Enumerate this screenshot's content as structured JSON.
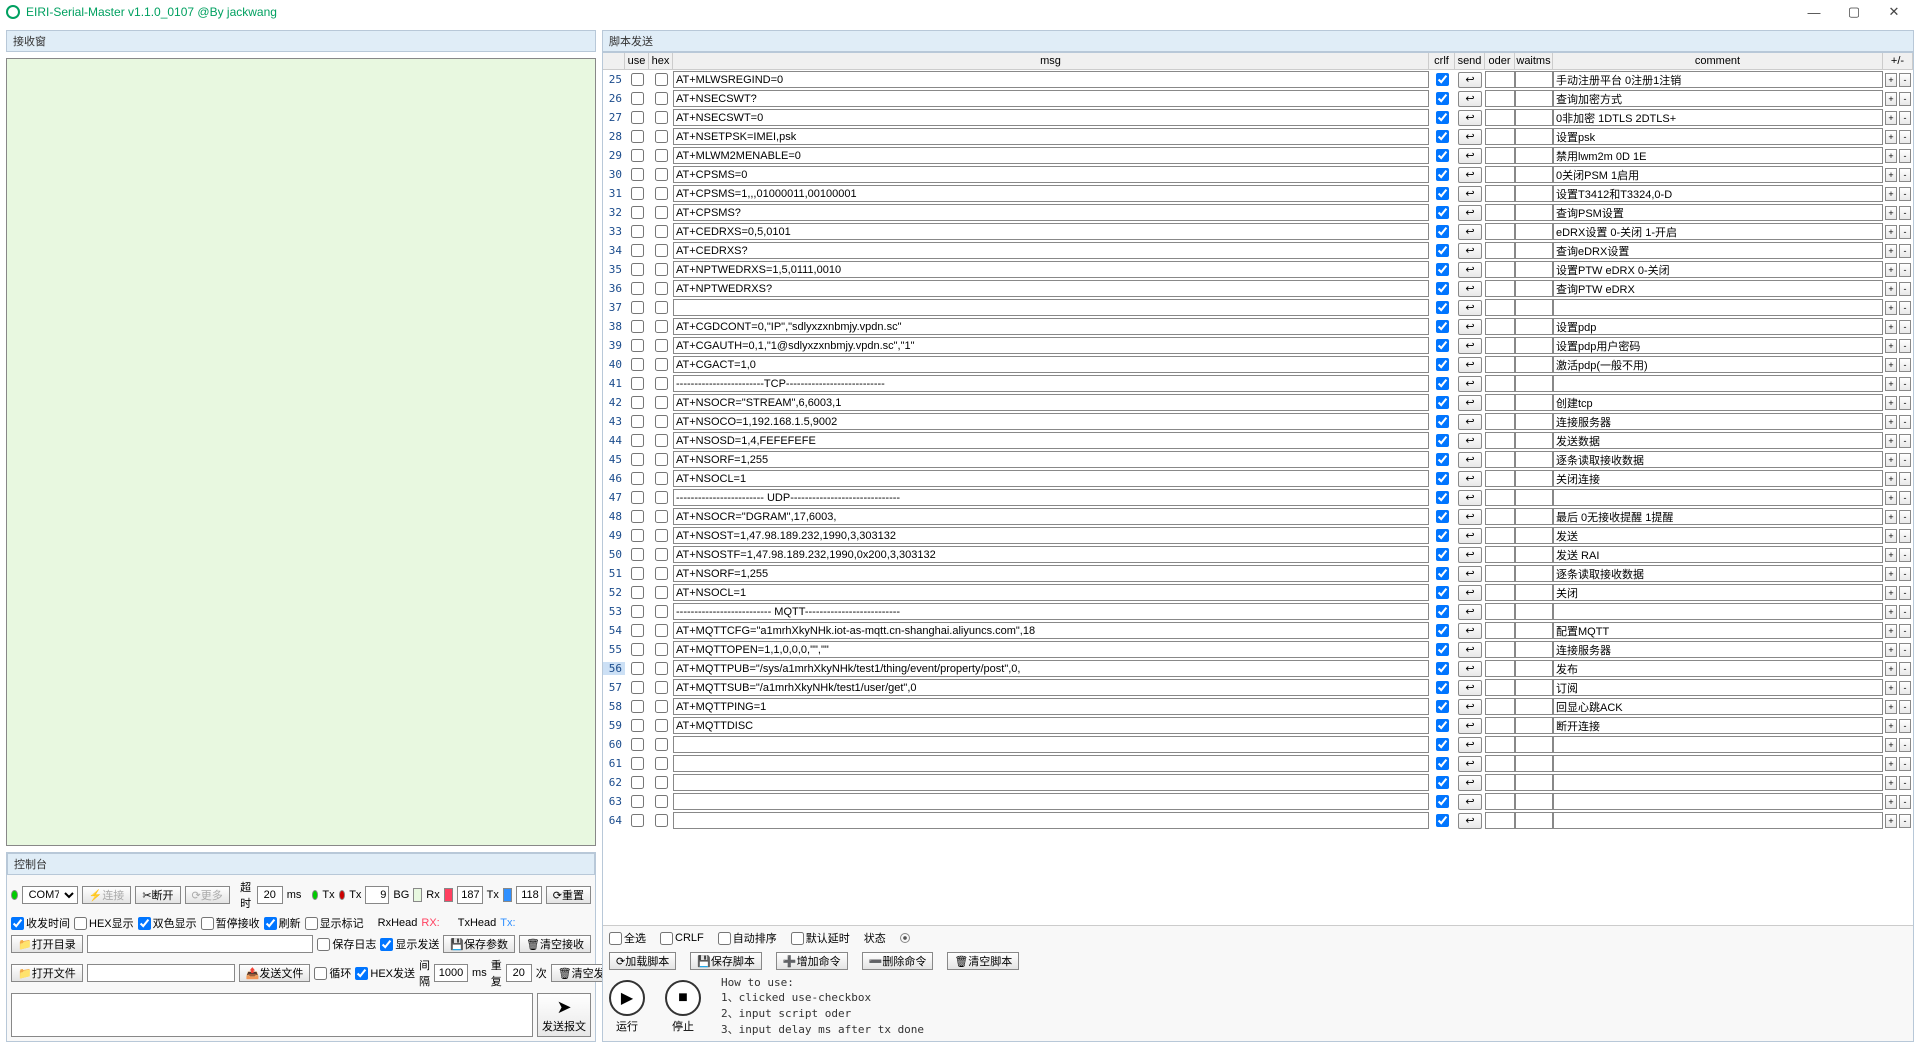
{
  "title": "EIRI-Serial-Master v1.1.0_0107 @By jackwang",
  "panels": {
    "receive": "接收窗",
    "control": "控制台",
    "script": "脚本发送"
  },
  "ctrl": {
    "port": "COM7",
    "connect": "连接",
    "disconnect": "断开",
    "more": "更多",
    "timeout_lbl": "超时",
    "timeout_val": "20",
    "ms": "ms",
    "tx_ok": "Tx",
    "tx_fail": "Tx",
    "tx_num": "9",
    "bg_lbl": "BG",
    "bg_color": "#e8f8e0",
    "rx_lbl": "Rx",
    "rx_color": "#ff4060",
    "rx_num": "187",
    "tx2_lbl": "Tx",
    "tx2_color": "#3090ff",
    "tx2_num": "118",
    "reset": "重置",
    "chk_time": "收发时间",
    "chk_hex": "HEX显示",
    "chk_twocolor": "双色显示",
    "chk_pause": "暂停接收",
    "chk_refresh": "刷新",
    "chk_marker": "显示标记",
    "rxhead_lbl": "RxHead",
    "rx_short": "RX:",
    "txhead_lbl": "TxHead",
    "tx_short": "Tx:",
    "open_dir": "打开目录",
    "open_file": "打开文件",
    "chk_savelog": "保存日志",
    "chk_showsend": "显示发送",
    "save_param": "保存参数",
    "clear_recv": "清空接收",
    "send_file": "发送文件",
    "chk_loop": "循环",
    "chk_hexsend": "HEX发送",
    "interval_lbl": "间隔",
    "interval_val": "1000",
    "interval_ms": "ms",
    "repeat_lbl": "重复",
    "repeat_val": "20",
    "times": "次",
    "clear_send": "清空发送",
    "send_msg": "发送报文"
  },
  "script_hdr": {
    "use": "use",
    "hex": "hex",
    "msg": "msg",
    "crlf": "crlf",
    "send": "send",
    "oder": "oder",
    "waitms": "waitms",
    "comment": "comment",
    "pm": "+/-"
  },
  "rows": [
    {
      "n": 25,
      "msg": "AT+MLWSREGIND=0",
      "comment": "手动注册平台 0注册1注销"
    },
    {
      "n": 26,
      "msg": "AT+NSECSWT?",
      "comment": "查询加密方式"
    },
    {
      "n": 27,
      "msg": "AT+NSECSWT=0",
      "comment": "0非加密 1DTLS 2DTLS+"
    },
    {
      "n": 28,
      "msg": "AT+NSETPSK=IMEI,psk",
      "comment": "设置psk"
    },
    {
      "n": 29,
      "msg": "AT+MLWM2MENABLE=0",
      "comment": "禁用lwm2m 0D 1E"
    },
    {
      "n": 30,
      "msg": "AT+CPSMS=0",
      "comment": "0关闭PSM 1启用"
    },
    {
      "n": 31,
      "msg": "AT+CPSMS=1,,,01000011,00100001",
      "comment": "设置T3412和T3324,0-D"
    },
    {
      "n": 32,
      "msg": "AT+CPSMS?",
      "comment": "查询PSM设置"
    },
    {
      "n": 33,
      "msg": "AT+CEDRXS=0,5,0101",
      "comment": "eDRX设置 0-关闭 1-开启"
    },
    {
      "n": 34,
      "msg": "AT+CEDRXS?",
      "comment": "查询eDRX设置"
    },
    {
      "n": 35,
      "msg": "AT+NPTWEDRXS=1,5,0111,0010",
      "comment": "设置PTW eDRX 0-关闭"
    },
    {
      "n": 36,
      "msg": "AT+NPTWEDRXS?",
      "comment": "查询PTW eDRX"
    },
    {
      "n": 37,
      "msg": "",
      "comment": ""
    },
    {
      "n": 38,
      "msg": "AT+CGDCONT=0,\"IP\",\"sdlyxzxnbmjy.vpdn.sc\"",
      "comment": "设置pdp"
    },
    {
      "n": 39,
      "msg": "AT+CGAUTH=0,1,\"1@sdlyxzxnbmjy.vpdn.sc\",\"1\"",
      "comment": "设置pdp用户密码"
    },
    {
      "n": 40,
      "msg": "AT+CGACT=1,0",
      "comment": "激活pdp(一般不用)"
    },
    {
      "n": 41,
      "msg": "------------------------TCP---------------------------",
      "comment": ""
    },
    {
      "n": 42,
      "msg": "AT+NSOCR=\"STREAM\",6,6003,1",
      "comment": "创建tcp"
    },
    {
      "n": 43,
      "msg": "AT+NSOCO=1,192.168.1.5,9002",
      "comment": "连接服务器"
    },
    {
      "n": 44,
      "msg": "AT+NSOSD=1,4,FEFEFEFE",
      "comment": "发送数据"
    },
    {
      "n": 45,
      "msg": "AT+NSORF=1,255",
      "comment": "逐条读取接收数据"
    },
    {
      "n": 46,
      "msg": "AT+NSOCL=1",
      "comment": "关闭连接"
    },
    {
      "n": 47,
      "msg": "------------------------ UDP------------------------------",
      "comment": ""
    },
    {
      "n": 48,
      "msg": "AT+NSOCR=\"DGRAM\",17,6003,",
      "comment": "最后 0无接收提醒 1提醒"
    },
    {
      "n": 49,
      "msg": "AT+NSOST=1,47.98.189.232,1990,3,303132",
      "comment": "发送"
    },
    {
      "n": 50,
      "msg": "AT+NSOSTF=1,47.98.189.232,1990,0x200,3,303132",
      "comment": "发送 RAI"
    },
    {
      "n": 51,
      "msg": "AT+NSORF=1,255",
      "comment": "逐条读取接收数据"
    },
    {
      "n": 52,
      "msg": "AT+NSOCL=1",
      "comment": "关闭"
    },
    {
      "n": 53,
      "msg": "-------------------------- MQTT--------------------------",
      "comment": ""
    },
    {
      "n": 54,
      "msg": "AT+MQTTCFG=\"a1mrhXkyNHk.iot-as-mqtt.cn-shanghai.aliyuncs.com\",18",
      "comment": "配置MQTT"
    },
    {
      "n": 55,
      "msg": "AT+MQTTOPEN=1,1,0,0,0,\"\",\"\"",
      "comment": "连接服务器"
    },
    {
      "n": 56,
      "hl": true,
      "msg": "AT+MQTTPUB=\"/sys/a1mrhXkyNHk/test1/thing/event/property/post\",0,",
      "comment": "发布"
    },
    {
      "n": 57,
      "msg": "AT+MQTTSUB=\"/a1mrhXkyNHk/test1/user/get\",0",
      "comment": "订阅"
    },
    {
      "n": 58,
      "msg": "AT+MQTTPING=1",
      "comment": "回显心跳ACK"
    },
    {
      "n": 59,
      "msg": "AT+MQTTDISC",
      "comment": "断开连接"
    },
    {
      "n": 60,
      "msg": "",
      "comment": ""
    },
    {
      "n": 61,
      "msg": "",
      "comment": ""
    },
    {
      "n": 62,
      "msg": "",
      "comment": ""
    },
    {
      "n": 63,
      "msg": "",
      "comment": ""
    },
    {
      "n": 64,
      "msg": "",
      "comment": ""
    }
  ],
  "bottom": {
    "chk_all": "全选",
    "chk_crlf": "CRLF",
    "chk_autosort": "自动排序",
    "chk_delay": "默认延时",
    "state_lbl": "状态",
    "load": "加载脚本",
    "save": "保存脚本",
    "addcmd": "增加命令",
    "delcmd": "删除命令",
    "clear": "清空脚本",
    "run": "运行",
    "stop": "停止",
    "help": "How to use:\n1、clicked use-checkbox\n2、input script oder\n3、input delay ms after tx done"
  }
}
